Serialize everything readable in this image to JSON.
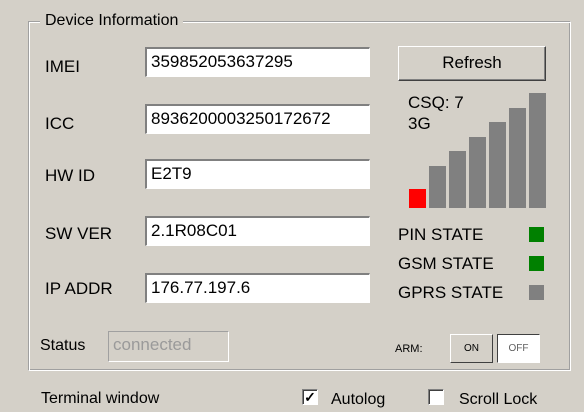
{
  "group_title": "Device Information",
  "fields": {
    "imei": {
      "label": "IMEI",
      "value": "359852053637295"
    },
    "icc": {
      "label": "ICC",
      "value": "8936200003250172672"
    },
    "hw_id": {
      "label": "HW ID",
      "value": "E2T9"
    },
    "sw_ver": {
      "label": "SW VER",
      "value": "2.1R08C01"
    },
    "ip_addr": {
      "label": "IP ADDR",
      "value": "176.77.197.6"
    }
  },
  "status": {
    "label": "Status",
    "value": "connected"
  },
  "refresh_label": "Refresh",
  "signal": {
    "csq_text": "CSQ: 7",
    "network_text": "3G",
    "bars_total": 7,
    "bars_active": 1,
    "active_color": "#ff0000",
    "inactive_color": "#808080"
  },
  "states": [
    {
      "label": "PIN STATE",
      "color": "#008000"
    },
    {
      "label": "GSM STATE",
      "color": "#008000"
    },
    {
      "label": "GPRS STATE",
      "color": "#808080"
    }
  ],
  "arm": {
    "label": "ARM:",
    "on_label": "ON",
    "off_label": "OFF",
    "selected": "OFF"
  },
  "footer": {
    "terminal_label": "Terminal window",
    "autolog_label": "Autolog",
    "autolog_checked": true,
    "autolog_mark": "✓",
    "scroll_lock_label": "Scroll Lock",
    "scroll_lock_checked": false
  }
}
